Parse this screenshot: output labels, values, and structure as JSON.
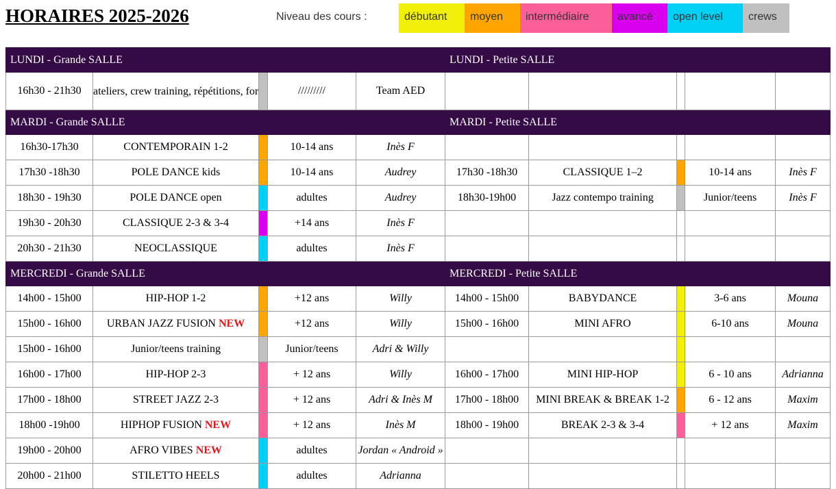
{
  "title": "HORAIRES 2025-2026",
  "legend": {
    "label": "Niveau des cours  :",
    "items": [
      {
        "label": "débutant",
        "color": "#f2ef0a"
      },
      {
        "label": "moyen",
        "color": "#ffa500"
      },
      {
        "label": "intermédiaire",
        "color": "#fa5f9a"
      },
      {
        "label": "avancé",
        "color": "#d800ef"
      },
      {
        "label": "open level",
        "color": "#00d1f4"
      },
      {
        "label": "crews",
        "color": "#c0c0c0"
      }
    ]
  },
  "days": {
    "lundi": {
      "left_header": "LUNDI - Grande SALLE",
      "right_header": "LUNDI - Petite SALLE",
      "left": [
        {
          "time": "16h30 - 21h30",
          "course": "ateliers, crew training, répétitions, formations…",
          "level": "#c0c0c0",
          "age": "/////////",
          "teacher": "Team AED"
        }
      ]
    },
    "mardi": {
      "left_header": "MARDI - Grande SALLE",
      "right_header": "MARDI - Petite SALLE",
      "left": [
        {
          "time": "16h30-17h30",
          "course": "CONTEMPORAIN 1-2",
          "level": "#ffa500",
          "age": "10-14 ans",
          "teacher": "Inès F"
        },
        {
          "time": "17h30 -18h30",
          "course": "POLE DANCE kids",
          "level": "#ffa500",
          "age": "10-14 ans",
          "teacher": "Audrey"
        },
        {
          "time": "18h30 - 19h30",
          "course": "POLE DANCE open",
          "level": "#00d1f4",
          "age": "adultes",
          "teacher": "Audrey"
        },
        {
          "time": "19h30 - 20h30",
          "course": "CLASSIQUE 2-3 & 3-4",
          "level": "#d800ef",
          "age": "+14 ans",
          "teacher": "Inès F"
        },
        {
          "time": "20h30 - 21h30",
          "course": "NEOCLASSIQUE",
          "level": "#00d1f4",
          "age": "adultes",
          "teacher": "Inès F"
        }
      ],
      "right": [
        null,
        {
          "time": "17h30 -18h30",
          "course": "CLASSIQUE 1–2",
          "level": "#ffa500",
          "age": "10-14 ans",
          "teacher": "Inès F"
        },
        {
          "time": "18h30-19h00",
          "course": "Jazz contempo training",
          "level": "#c0c0c0",
          "age": "Junior/teens",
          "teacher": "Inès F"
        },
        null,
        null
      ]
    },
    "mercredi": {
      "left_header": "MERCREDI - Grande SALLE",
      "right_header": "MERCREDI - Petite SALLE",
      "left": [
        {
          "time": "14h00 - 15h00",
          "course": "HIP-HOP 1-2",
          "level": "#ffa500",
          "age": "+12 ans",
          "teacher": "Willy"
        },
        {
          "time": "15h00 - 16h00",
          "course": "URBAN JAZZ FUSION",
          "new": "NEW",
          "level": "#ffa500",
          "age": "+12 ans",
          "teacher": "Willy"
        },
        {
          "time": "15h00 - 16h00",
          "course": "Junior/teens training",
          "level": "#c0c0c0",
          "age": "Junior/teens",
          "teacher": "Adri & Willy"
        },
        {
          "time": "16h00 - 17h00",
          "course": "HIP-HOP 2-3",
          "level": "#fa5f9a",
          "age": "+ 12 ans",
          "teacher": "Willy"
        },
        {
          "time": "17h00 - 18h00",
          "course": "STREET JAZZ 2-3",
          "level": "#fa5f9a",
          "age": "+ 12 ans",
          "teacher": "Adri & Inès M"
        },
        {
          "time": "18h00 -19h00",
          "course": "HIPHOP FUSION",
          "new": "NEW",
          "level": "#fa5f9a",
          "age": "+ 12 ans",
          "teacher": "Inès M"
        },
        {
          "time": "19h00 - 20h00",
          "course": "AFRO VIBES",
          "new": "NEW",
          "level": "#00d1f4",
          "age": "adultes",
          "teacher": "Jordan « Android »"
        },
        {
          "time": "20h00 - 21h00",
          "course": "STILETTO HEELS",
          "level": "#00d1f4",
          "age": "adultes",
          "teacher": "Adrianna"
        }
      ],
      "right": [
        {
          "time": "14h00 - 15h00",
          "course": "BABYDANCE",
          "level": "#f2ef0a",
          "age": "3-6 ans",
          "teacher": "Mouna"
        },
        {
          "time": "15h00 - 16h00",
          "course": "MINI AFRO",
          "level": "#f2ef0a",
          "age": "6-10 ans",
          "teacher": "Mouna"
        },
        {
          "time": "",
          "course": "",
          "level": "#f2ef0a",
          "age": "",
          "teacher": ""
        },
        {
          "time": "16h00 - 17h00",
          "course": "MINI HIP-HOP",
          "level": "#f2ef0a",
          "age": "6 - 10 ans",
          "teacher": "Adrianna"
        },
        {
          "time": "17h00 - 18h00",
          "course": "MINI BREAK & BREAK 1-2",
          "level": "#ffa500",
          "age": "6 - 12 ans",
          "teacher": "Maxim"
        },
        {
          "time": "18h00 - 19h00",
          "course": "BREAK 2-3 & 3-4",
          "level": "#fa5f9a",
          "age": "+ 12 ans",
          "teacher": "Maxim"
        },
        null,
        null
      ]
    }
  }
}
